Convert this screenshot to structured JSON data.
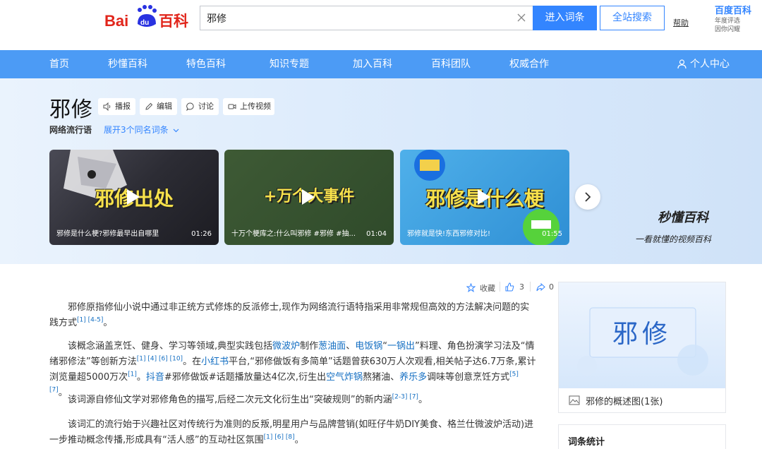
{
  "header": {
    "search_value": "邪修",
    "enter_button": "进入词条",
    "all_search_button": "全站搜索",
    "help": "帮助",
    "brand": "百度百科",
    "brand_sub1": "年度评选",
    "brand_sub2": "因你闪耀"
  },
  "nav": {
    "items": [
      "首页",
      "秒懂百科",
      "特色百科",
      "知识专题",
      "加入百科",
      "百科团队",
      "权威合作"
    ],
    "user_center": "个人中心"
  },
  "entry": {
    "title": "邪修",
    "tools": [
      "播报",
      "编辑",
      "讨论",
      "上传视频"
    ],
    "category": "网络流行语",
    "expand_synonyms": "展开3个同名词条"
  },
  "videos": [
    {
      "overlay": "邪修出处",
      "title": "邪修是什么梗?邪修最早出自哪里",
      "duration": "01:26"
    },
    {
      "overlay": "+万个大事件",
      "title": "十万个梗库之:什么叫邪修 #邪修 #抽...",
      "duration": "01:04"
    },
    {
      "overlay": "邪修是什么梗",
      "title": "邪修就是快!东西邪修对比!",
      "duration": "01:55"
    }
  ],
  "miaodong": {
    "logo": "秒懂百科",
    "slogan": "一看就懂的视频百科"
  },
  "meta": {
    "collect": "收藏",
    "likes": "3",
    "shares": "0"
  },
  "paragraphs": {
    "p1_text": "邪修原指修仙小说中通过非正统方式修炼的反派修士,现作为网络流行语特指采用非常规但高效的方法解决问题的实践方式",
    "p1_refs": "[1] [4-5]",
    "p2_a": "该概念涵盖烹饪、健身、学习等领域,典型实践包括",
    "p2_link1": "微波炉",
    "p2_b": "制作",
    "p2_link2": "葱油面",
    "p2_c": "、",
    "p2_link3": "电饭锅",
    "p2_d": "“",
    "p2_link4": "一锅出",
    "p2_e": "”料理、角色扮演学习法及“情绪邪修法”等创新方法",
    "p2_refs1": "[1] [4] [6] [10]",
    "p2_f": "。在",
    "p2_link5": "小红书",
    "p2_g": "平台,“邪修做饭有多简单”话题曾获630万人次观看,相关帖子达6.7万条,累计浏览量超5000万次",
    "p2_refs2": "[1]",
    "p2_h": "。",
    "p2_link6": "抖音",
    "p2_i": "#邪修做饭#话题播放量达4亿次,衍生出",
    "p2_link7": "空气炸锅",
    "p2_j": "熬猪油、",
    "p2_link8": "养乐多",
    "p2_k": "调味等创意烹饪方式",
    "p2_refs3": "[5] [7]",
    "p2_l": "。",
    "p3_text": "该词源自修仙文学对邪修角色的描写,后经二次元文化衍生出“突破规则”的新内涵",
    "p3_refs": "[2-3] [7]",
    "p3_end": "。",
    "p4_text": "该词汇的流行始于兴趣社区对传统行为准则的反叛,明星用户与品牌营销(如旺仔牛奶DIY美食、格兰仕微波炉活动)进一步推动概念传播,形成具有“活人感”的互动社区氛围",
    "p4_refs": "[1] [6] [8]",
    "p4_end": "。"
  },
  "sidebar": {
    "card_word": "邪修",
    "card_caption": "邪修的概述图(1张)",
    "stats_title": "词条统计"
  },
  "colors": {
    "nav_bg": "#4c9bf5",
    "accent": "#3385ff",
    "link": "#136ec2"
  }
}
